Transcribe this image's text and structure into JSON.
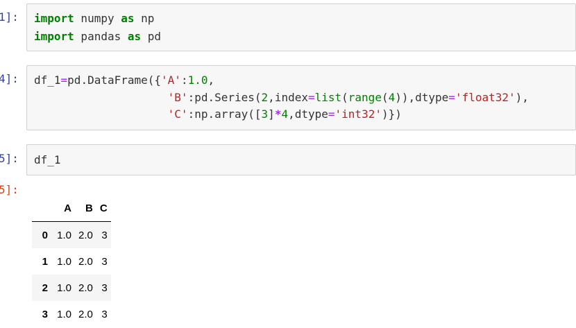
{
  "cells": [
    {
      "prompt": "1]:",
      "lines": [
        [
          {
            "t": "import",
            "c": "kw"
          },
          {
            "t": " numpy ",
            "c": ""
          },
          {
            "t": "as",
            "c": "kw"
          },
          {
            "t": " np",
            "c": ""
          }
        ],
        [
          {
            "t": "import",
            "c": "kw"
          },
          {
            "t": " pandas ",
            "c": ""
          },
          {
            "t": "as",
            "c": "kw"
          },
          {
            "t": " pd",
            "c": ""
          }
        ]
      ]
    },
    {
      "prompt": "4]:",
      "lines": [
        [
          {
            "t": "df_1",
            "c": ""
          },
          {
            "t": "=",
            "c": "eq"
          },
          {
            "t": "pd.DataFrame({",
            "c": ""
          },
          {
            "t": "'A'",
            "c": "str"
          },
          {
            "t": ":",
            "c": ""
          },
          {
            "t": "1.0",
            "c": "num"
          },
          {
            "t": ",",
            "c": ""
          }
        ],
        [
          {
            "t": "                    ",
            "c": ""
          },
          {
            "t": "'B'",
            "c": "str"
          },
          {
            "t": ":pd.Series(",
            "c": ""
          },
          {
            "t": "2",
            "c": "num"
          },
          {
            "t": ",index",
            "c": ""
          },
          {
            "t": "=",
            "c": "eq"
          },
          {
            "t": "list",
            "c": "bi"
          },
          {
            "t": "(",
            "c": ""
          },
          {
            "t": "range",
            "c": "bi"
          },
          {
            "t": "(",
            "c": ""
          },
          {
            "t": "4",
            "c": "num"
          },
          {
            "t": ")),dtype",
            "c": ""
          },
          {
            "t": "=",
            "c": "eq"
          },
          {
            "t": "'float32'",
            "c": "str"
          },
          {
            "t": "),",
            "c": ""
          }
        ],
        [
          {
            "t": "                    ",
            "c": ""
          },
          {
            "t": "'C'",
            "c": "str"
          },
          {
            "t": ":np.array([",
            "c": ""
          },
          {
            "t": "3",
            "c": "num"
          },
          {
            "t": "]",
            "c": ""
          },
          {
            "t": "*",
            "c": "op"
          },
          {
            "t": "4",
            "c": "num"
          },
          {
            "t": ",dtype",
            "c": ""
          },
          {
            "t": "=",
            "c": "eq"
          },
          {
            "t": "'int32'",
            "c": "str"
          },
          {
            "t": ")})",
            "c": ""
          }
        ]
      ]
    },
    {
      "prompt": "5]:",
      "lines": [
        [
          {
            "t": "df_1",
            "c": ""
          }
        ]
      ]
    }
  ],
  "output": {
    "prompt": "5]:",
    "table": {
      "columns": [
        "",
        "A",
        "B",
        "C"
      ],
      "rows": [
        {
          "index": "0",
          "A": "1.0",
          "B": "2.0",
          "C": "3"
        },
        {
          "index": "1",
          "A": "1.0",
          "B": "2.0",
          "C": "3"
        },
        {
          "index": "2",
          "A": "1.0",
          "B": "2.0",
          "C": "3"
        },
        {
          "index": "3",
          "A": "1.0",
          "B": "2.0",
          "C": "3"
        }
      ]
    }
  }
}
